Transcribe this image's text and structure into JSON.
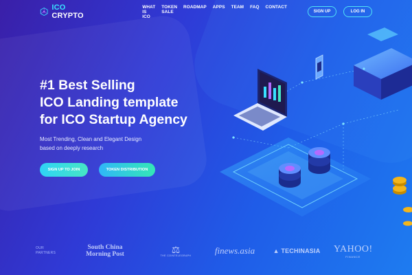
{
  "header": {
    "logo_icon": "hex-network-icon",
    "logo_ico": "ICO",
    "logo_rest": " CRYPTO",
    "nav": [
      "WHAT IS ICO",
      "TOKEN SALE",
      "ROADMAP",
      "APPS",
      "TEAM",
      "FAQ",
      "CONTACT"
    ],
    "signup_label": "SIGN UP",
    "login_label": "LOG IN"
  },
  "hero": {
    "title_line1": "#1 Best Selling",
    "title_line2": "ICO Landing template",
    "title_line3": "for ICO Startup Agency",
    "subtitle_line1": "Most Trending, Clean and Elegant Design",
    "subtitle_line2": "based on deeply research",
    "cta_primary": "SIGN UP TO JOIN",
    "cta_secondary": "TOKEN DISTRIBUTION"
  },
  "partners": {
    "label_line1": "OUR",
    "label_line2": "PARTNERS",
    "logos": [
      {
        "line1": "South China",
        "line2": "Morning Post"
      },
      {
        "name": "THE COINTELEGRAPH"
      },
      {
        "name": "finews.asia"
      },
      {
        "name": "TECHINASIA"
      },
      {
        "name": "YAHOO!",
        "sub": "FINANCE"
      }
    ]
  },
  "colors": {
    "accent_cyan": "#38e0ff",
    "cta_gradient_start": "#2fd3f6",
    "cta_gradient_end": "#46e6c4"
  },
  "illustration_icons": [
    "laptop-chart-icon",
    "coin-stack-icon",
    "server-block-icon",
    "phone-icon",
    "gold-coin-icon"
  ]
}
